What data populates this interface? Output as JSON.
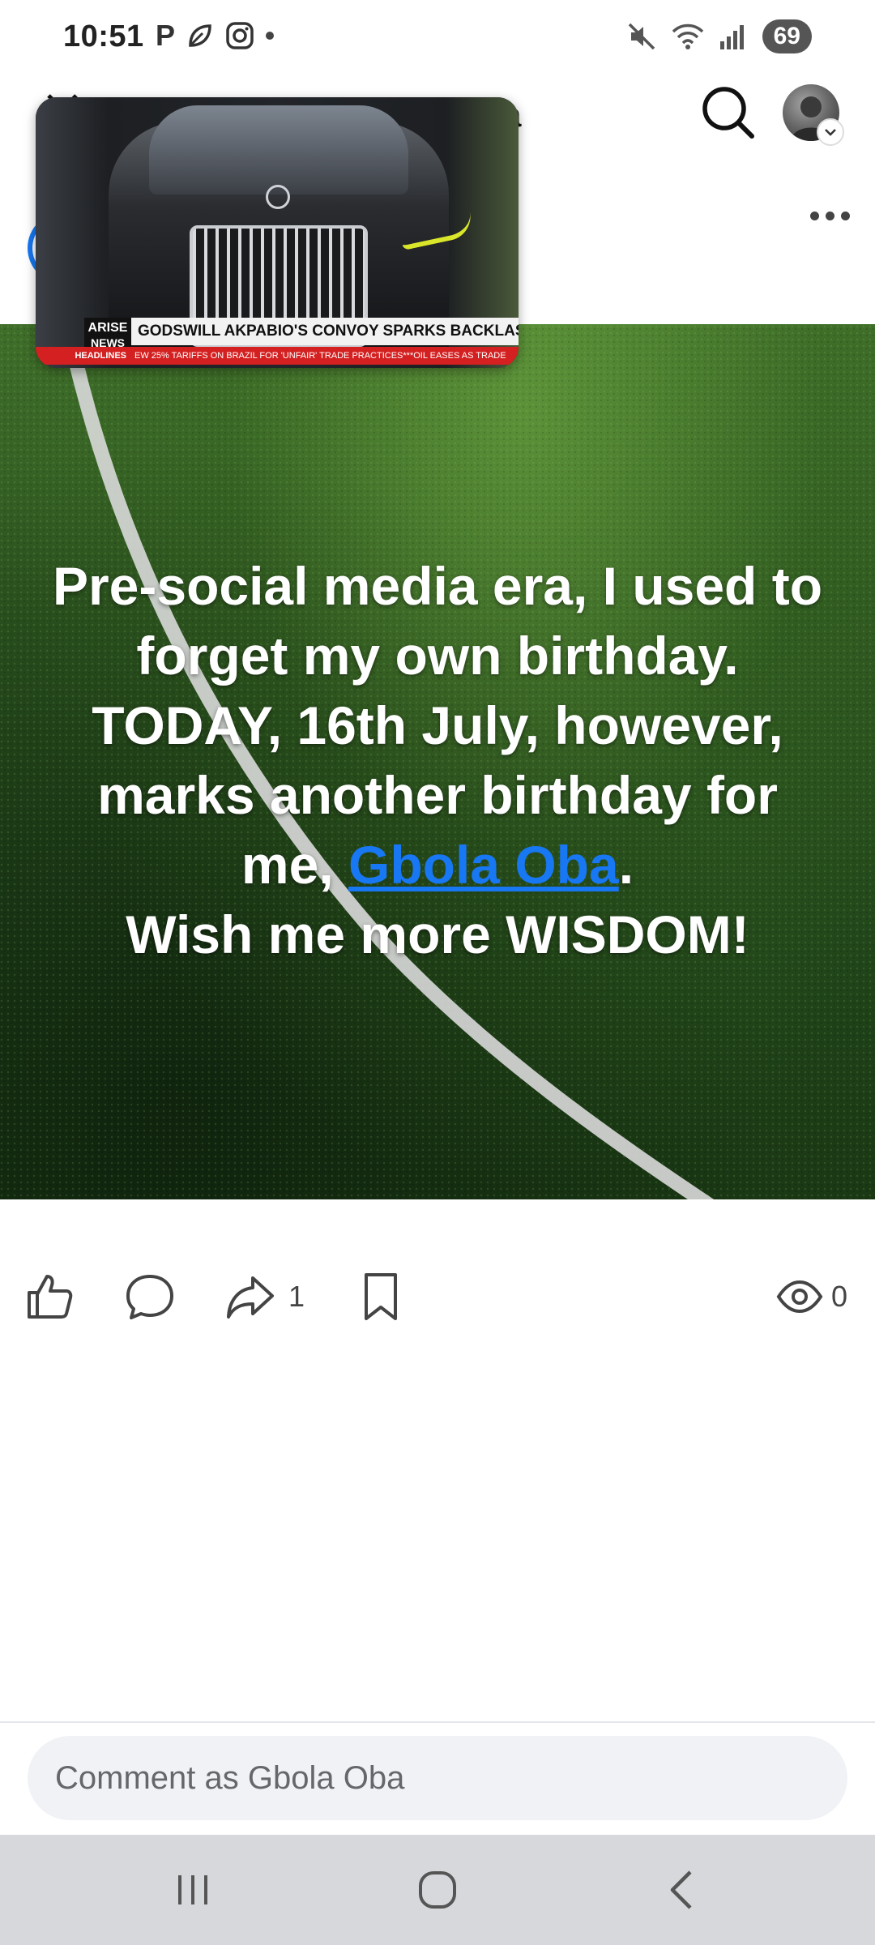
{
  "status_bar": {
    "time": "10:51",
    "left_icons": [
      "parking-icon",
      "leaf-icon",
      "instagram-icon",
      "notification-dot-icon"
    ],
    "right_icons": [
      "mute-icon",
      "wifi-icon",
      "signal-icon"
    ],
    "battery": "69"
  },
  "header": {
    "title_fragment": "a",
    "icons": [
      "close-icon",
      "search-icon",
      "profile-avatar",
      "more-icon"
    ]
  },
  "pip_video": {
    "channel_logo_line1": "ARISE",
    "channel_logo_line2": "NEWS",
    "headline": "GODSWILL AKPABIO'S CONVOY SPARKS BACKLASH",
    "ticker_label": "HEADLINES",
    "ticker": "EW 25% TARIFFS ON BRAZIL FOR 'UNFAIR' TRADE PRACTICES***OIL EASES AS TRADE"
  },
  "post": {
    "text_before": "Pre-social media era, I used to forget my own birthday. TODAY, 16th July, however, marks another birthday for me,",
    "mention": "Gbola Oba",
    "text_after_mention": ".",
    "text_last_line": "Wish me more WISDOM!",
    "background_colors": {
      "grass": "#2d5620",
      "line": "#d9d9d9"
    }
  },
  "actions": {
    "share_count": "1",
    "views_count": "0",
    "icons": [
      "like-icon",
      "comment-icon",
      "share-icon",
      "bookmark-icon",
      "views-icon"
    ]
  },
  "composer": {
    "placeholder": "Comment as Gbola Oba"
  },
  "nav_bar": {
    "buttons": [
      "recent-apps-icon",
      "home-icon",
      "back-icon"
    ]
  },
  "colors": {
    "accent": "#1877f2",
    "nav_bg": "#d6d8dc",
    "input_bg": "#f0f2f5"
  }
}
